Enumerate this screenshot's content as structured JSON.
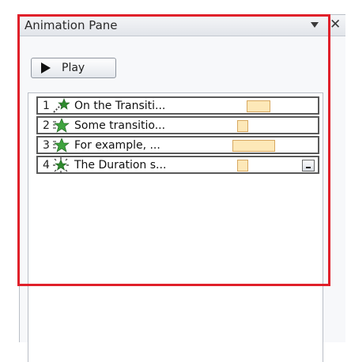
{
  "pane": {
    "title": "Animation Pane",
    "close_glyph": "✕"
  },
  "toolbar": {
    "play_label": "Play"
  },
  "animations": [
    {
      "number": "1",
      "text": "On the Transiti...",
      "icon": "fly-in-star-icon",
      "duration_fraction": 0.17
    },
    {
      "number": "2",
      "text": "Some transitio...",
      "icon": "fade-star-icon",
      "duration_fraction": 0.08
    },
    {
      "number": "3",
      "text": "For example, ...",
      "icon": "fade-star-icon",
      "duration_fraction": 0.31
    },
    {
      "number": "4",
      "text": "The Duration s...",
      "icon": "burst-star-icon",
      "duration_fraction": 0.08
    }
  ],
  "colors": {
    "timing_bar": "#fde8b8",
    "highlight_border": "#e0202a",
    "star_green": "#2e8b2e"
  }
}
